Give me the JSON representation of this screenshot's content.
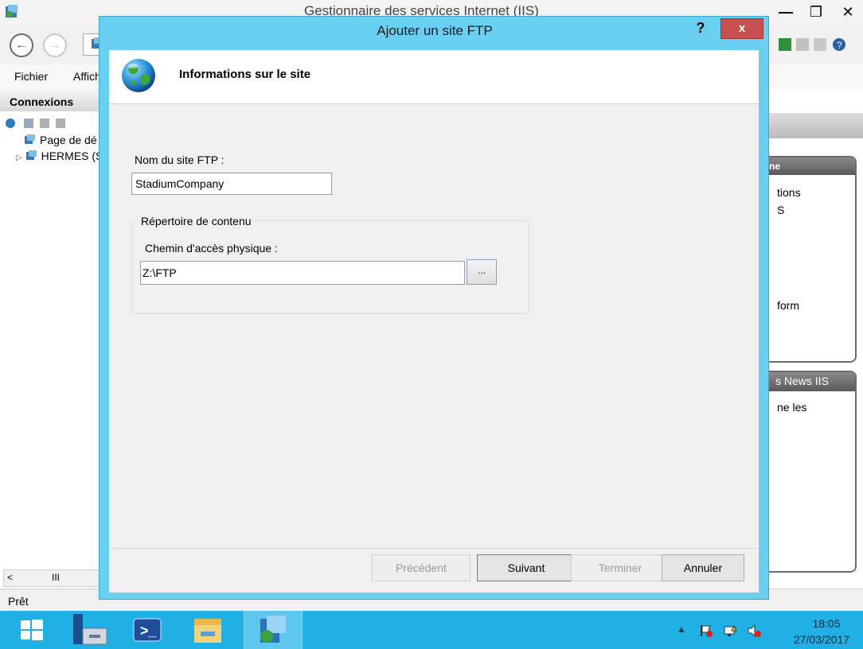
{
  "background_window": {
    "title": "Gestionnaire des services Internet (IIS)",
    "menu": {
      "file": "Fichier",
      "view": "Affich"
    },
    "connections": {
      "header": "Connexions",
      "tree": [
        {
          "label": "Page de dé"
        },
        {
          "label": "HERMES (S"
        }
      ]
    },
    "right_panel_1": {
      "header": "ne",
      "lines": [
        "tions",
        "S",
        "form"
      ]
    },
    "right_panel_2": {
      "header": "s News IIS",
      "lines": [
        "ne les"
      ]
    },
    "status": "Prêt"
  },
  "dialog": {
    "title": "Ajouter un site FTP",
    "help_label": "?",
    "close_label": "x",
    "heading": "Informations sur le site",
    "site_name_label": "Nom du site FTP :",
    "site_name_value": "StadiumCompany",
    "content_group_label": "Répertoire de contenu",
    "physical_path_label": "Chemin d'accès physique :",
    "physical_path_value": "Z:\\FTP",
    "browse_label": "...",
    "buttons": {
      "previous": "Précédent",
      "next": "Suivant",
      "finish": "Terminer",
      "cancel": "Annuler"
    }
  },
  "taskbar": {
    "clock_time": "18:05",
    "clock_date": "27/03/2017"
  },
  "colors": {
    "dialog_frame": "#6ad0f2",
    "close_button": "#c75050",
    "taskbar": "#1fb0e6",
    "dialog_client": "#f0f0f0"
  },
  "icons": [
    "iis-app-icon",
    "back-arrow-icon",
    "forward-arrow-icon",
    "globe-icon",
    "windows-start-icon",
    "server-manager-icon",
    "powershell-icon",
    "file-explorer-icon",
    "iis-manager-icon",
    "flag-icon",
    "network-icon",
    "volume-icon"
  ]
}
